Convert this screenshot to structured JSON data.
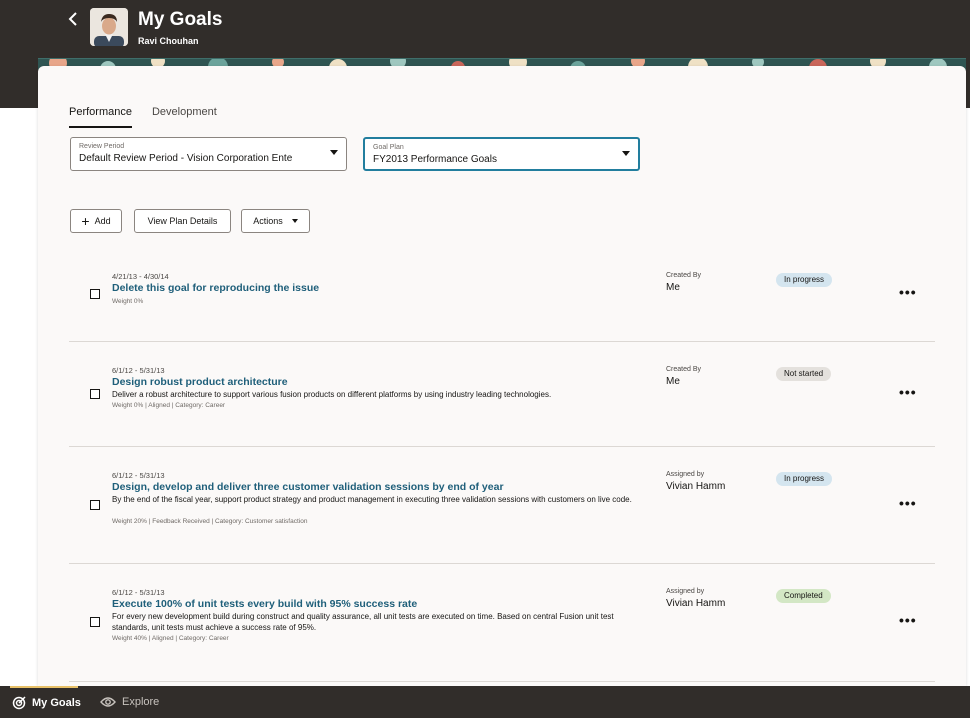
{
  "header": {
    "title": "My Goals",
    "subtitle": "Ravi Chouhan"
  },
  "tabs": [
    {
      "label": "Performance",
      "active": true
    },
    {
      "label": "Development",
      "active": false
    }
  ],
  "filters": {
    "review_period": {
      "label": "Review Period",
      "value": "Default Review Period - Vision Corporation Ente"
    },
    "goal_plan": {
      "label": "Goal Plan",
      "value": "FY2013 Performance Goals"
    }
  },
  "toolbar": {
    "add_label": "Add",
    "view_plan_label": "View Plan Details",
    "actions_label": "Actions"
  },
  "goals": [
    {
      "dates": "4/21/13 - 4/30/14",
      "title": "Delete this goal for reproducing the issue",
      "description": "",
      "meta": "Weight 0%",
      "by_label": "Created By",
      "by_value": "Me",
      "status": "In progress"
    },
    {
      "dates": "6/1/12 - 5/31/13",
      "title": "Design robust product architecture",
      "description": "Deliver a robust architecture to support various fusion products on different platforms by using industry leading technologies.",
      "meta": "Weight 0% | Aligned | Category: Career",
      "by_label": "Created By",
      "by_value": "Me",
      "status": "Not started"
    },
    {
      "dates": "6/1/12 - 5/31/13",
      "title": "Design, develop and deliver three customer validation sessions by end of year",
      "description": "By the end of the fiscal year, support product strategy and product management in executing three validation sessions with customers on live code.",
      "meta": "Weight 20% | Feedback Received | Category: Customer satisfaction",
      "by_label": "Assigned by",
      "by_value": "Vivian Hamm",
      "status": "In progress"
    },
    {
      "dates": "6/1/12 - 5/31/13",
      "title": "Execute 100% of unit tests every build with 95% success rate",
      "description": "For every new development build during construct and quality assurance, all unit tests are executed on time. Based on central Fusion unit test standards, unit tests must achieve a success rate of 95%.",
      "meta": "Weight 40% | Aligned | Category: Career",
      "by_label": "Assigned by",
      "by_value": "Vivian Hamm",
      "status": "Completed"
    }
  ],
  "more_glyph": "•••",
  "bottom_nav": [
    {
      "label": "My Goals",
      "active": true,
      "icon": "target-icon"
    },
    {
      "label": "Explore",
      "active": false,
      "icon": "eye-icon"
    }
  ],
  "colors": {
    "header_bg": "#312d2a",
    "link": "#1f5f7a",
    "focus": "#227e9e",
    "in_progress": "#d4e5ef",
    "not_started": "#e4e1dd",
    "completed": "#d3e7c5",
    "nav_accent": "#e8c168"
  }
}
